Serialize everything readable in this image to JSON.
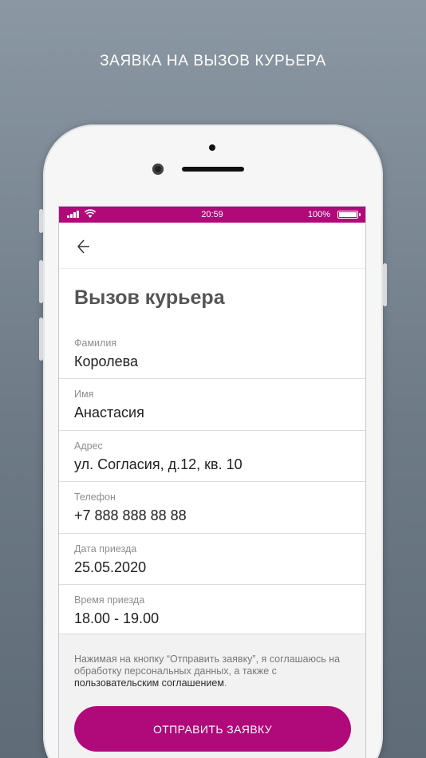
{
  "promo": {
    "title": "ЗАЯВКА НА ВЫЗОВ КУРЬЕРА"
  },
  "status_bar": {
    "time": "20:59",
    "battery": "100%"
  },
  "page": {
    "title": "Вызов курьера"
  },
  "fields": [
    {
      "label": "Фамилия",
      "value": "Королева"
    },
    {
      "label": "Имя",
      "value": "Анастасия"
    },
    {
      "label": "Адрес",
      "value": "ул. Согласия, д.12, кв. 10"
    },
    {
      "label": "Телефон",
      "value": "+7 888 888 88 88"
    },
    {
      "label": "Дата приезда",
      "value": "25.05.2020"
    },
    {
      "label": "Время приезда",
      "value": "18.00 - 19.00"
    }
  ],
  "consent": {
    "text": "Нажимая на кнопку “Отправить заявку”, я соглашаюсь на обработку персональных данных, а также с ",
    "link": "пользовательским соглашением",
    "end": "."
  },
  "submit": {
    "label": "ОТПРАВИТЬ ЗАЯВКУ"
  },
  "colors": {
    "accent": "#b0097a",
    "background": "#6e7b87"
  },
  "icons": [
    "signal-icon",
    "wifi-icon",
    "battery-icon",
    "back-arrow-icon"
  ]
}
